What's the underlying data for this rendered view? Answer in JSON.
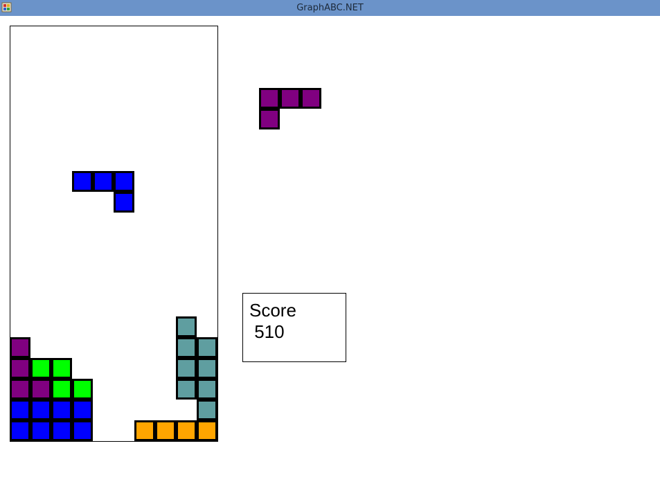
{
  "window": {
    "title": "GraphABC.NET",
    "icon": "app-icon"
  },
  "score": {
    "label": "Score",
    "value": " 510"
  },
  "colors": {
    "purple": "#800080",
    "blue": "#0000ff",
    "green": "#00ff00",
    "teal": "#5f9ea0",
    "orange": "#ffa500",
    "titlebar": "#6b93c9"
  },
  "board": {
    "columns": 10,
    "rows": 20,
    "active_piece": {
      "color": "blue",
      "cells": [
        [
          3,
          7
        ],
        [
          4,
          7
        ],
        [
          5,
          7
        ],
        [
          5,
          8
        ]
      ]
    },
    "settled_cells": [
      {
        "col": 0,
        "row": 15,
        "color": "purple"
      },
      {
        "col": 0,
        "row": 16,
        "color": "purple"
      },
      {
        "col": 0,
        "row": 17,
        "color": "purple"
      },
      {
        "col": 1,
        "row": 17,
        "color": "purple"
      },
      {
        "col": 1,
        "row": 16,
        "color": "green"
      },
      {
        "col": 2,
        "row": 16,
        "color": "green"
      },
      {
        "col": 2,
        "row": 17,
        "color": "green"
      },
      {
        "col": 3,
        "row": 17,
        "color": "green"
      },
      {
        "col": 0,
        "row": 18,
        "color": "blue"
      },
      {
        "col": 1,
        "row": 18,
        "color": "blue"
      },
      {
        "col": 2,
        "row": 18,
        "color": "blue"
      },
      {
        "col": 3,
        "row": 18,
        "color": "blue"
      },
      {
        "col": 0,
        "row": 19,
        "color": "blue"
      },
      {
        "col": 1,
        "row": 19,
        "color": "blue"
      },
      {
        "col": 2,
        "row": 19,
        "color": "blue"
      },
      {
        "col": 3,
        "row": 19,
        "color": "blue"
      },
      {
        "col": 8,
        "row": 14,
        "color": "teal"
      },
      {
        "col": 8,
        "row": 15,
        "color": "teal"
      },
      {
        "col": 8,
        "row": 16,
        "color": "teal"
      },
      {
        "col": 8,
        "row": 17,
        "color": "teal"
      },
      {
        "col": 9,
        "row": 15,
        "color": "teal"
      },
      {
        "col": 9,
        "row": 16,
        "color": "teal"
      },
      {
        "col": 9,
        "row": 17,
        "color": "teal"
      },
      {
        "col": 9,
        "row": 18,
        "color": "teal"
      },
      {
        "col": 6,
        "row": 19,
        "color": "orange"
      },
      {
        "col": 7,
        "row": 19,
        "color": "orange"
      },
      {
        "col": 8,
        "row": 19,
        "color": "orange"
      },
      {
        "col": 9,
        "row": 19,
        "color": "orange"
      }
    ]
  },
  "next_piece": {
    "color": "purple",
    "cells": [
      [
        0,
        0
      ],
      [
        1,
        0
      ],
      [
        2,
        0
      ],
      [
        0,
        1
      ]
    ]
  }
}
